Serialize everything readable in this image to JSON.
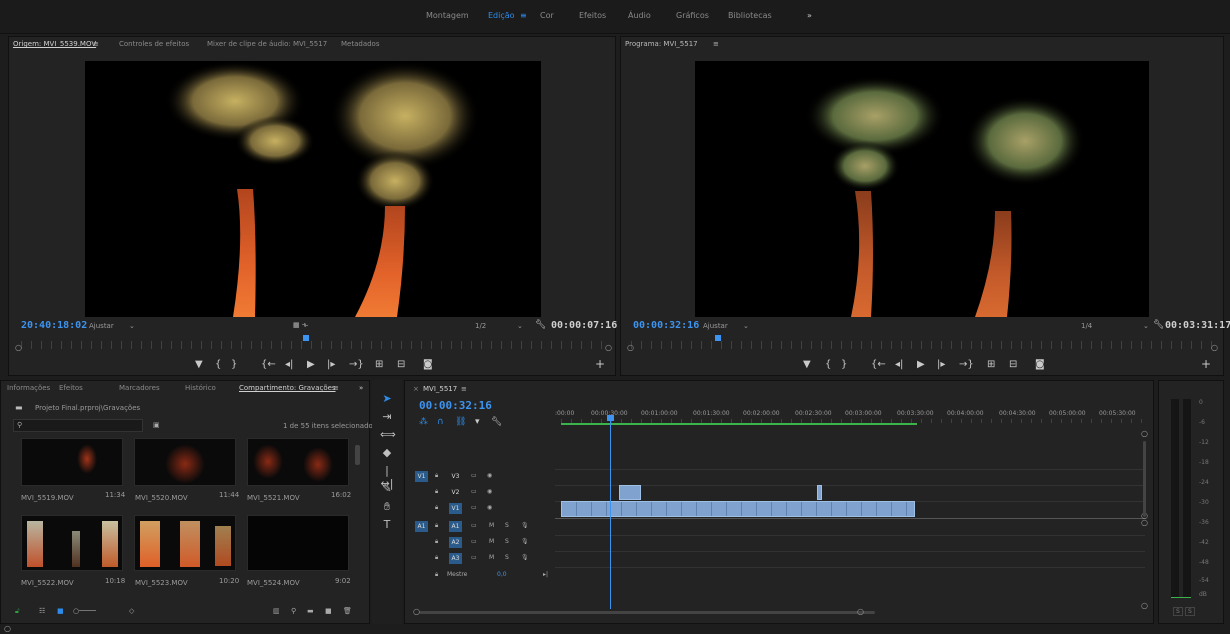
{
  "workspaces": {
    "items": [
      "Montagem",
      "Edição",
      "Cor",
      "Efeitos",
      "Áudio",
      "Gráficos",
      "Bibliotecas"
    ],
    "active_index": 1,
    "more": "»"
  },
  "source_monitor": {
    "tabs": [
      "Origem: MVI_5539.MOV",
      "Controles de efeitos",
      "Mixer de clipe de áudio: MVI_5517",
      "Metadados"
    ],
    "menu_glyph": "≡",
    "timecode": "20:40:18:02",
    "fit_label": "Ajustar",
    "resolution": "1/2",
    "duration": "00:00:07:16"
  },
  "program_monitor": {
    "title": "Programa: MVI_5517",
    "menu_glyph": "≡",
    "timecode": "00:00:32:16",
    "fit_label": "Ajustar",
    "resolution": "1/4",
    "duration": "00:03:31:17"
  },
  "project": {
    "tabs": [
      "Informações",
      "Efeitos",
      "Marcadores",
      "Histórico",
      "Compartimento: Gravações"
    ],
    "menu_glyph": "≡",
    "more": "»",
    "path": "Projeto Final.prproj\\Gravações",
    "item_count": "1 de 55 itens selecionados",
    "clips": [
      {
        "name": "MVI_5519.MOV",
        "duration": "11:34"
      },
      {
        "name": "MVI_5520.MOV",
        "duration": "11:44"
      },
      {
        "name": "MVI_5521.MOV",
        "duration": "16:02"
      },
      {
        "name": "MVI_5522.MOV",
        "duration": "10:18"
      },
      {
        "name": "MVI_5523.MOV",
        "duration": "10:20"
      },
      {
        "name": "MVI_5524.MOV",
        "duration": "9:02"
      }
    ]
  },
  "timeline": {
    "sequence": "MVI_5517",
    "menu_glyph": "≡",
    "close": "×",
    "timecode": "00:00:32:16",
    "ruler": [
      ":00:00",
      "00:00:30:00",
      "00:01:00:00",
      "00:01:30:00",
      "00:02:00:00",
      "00:02:30:00",
      "00:03:00:00",
      "00:03:30:00",
      "00:04:00:00",
      "00:04:30:00",
      "00:05:00:00",
      "00:05:30:00"
    ],
    "video_tracks": [
      "V3",
      "V2",
      "V1"
    ],
    "audio_tracks": [
      "A1",
      "A2",
      "A3"
    ],
    "source_v": "V1",
    "source_a": "A1",
    "master_label": "Mestre",
    "master_value": "0,0",
    "m_label": "M",
    "s_label": "S"
  },
  "meter": {
    "scale": [
      "0",
      "-6",
      "-12",
      "-18",
      "-24",
      "-30",
      "-36",
      "-42",
      "-48",
      "-54",
      "dB"
    ],
    "solo_left": "S",
    "solo_right": "S"
  },
  "colors": {
    "accent": "#2d8ceb",
    "clip": "#7fa2cf",
    "track_on": "#2a5b8a"
  }
}
